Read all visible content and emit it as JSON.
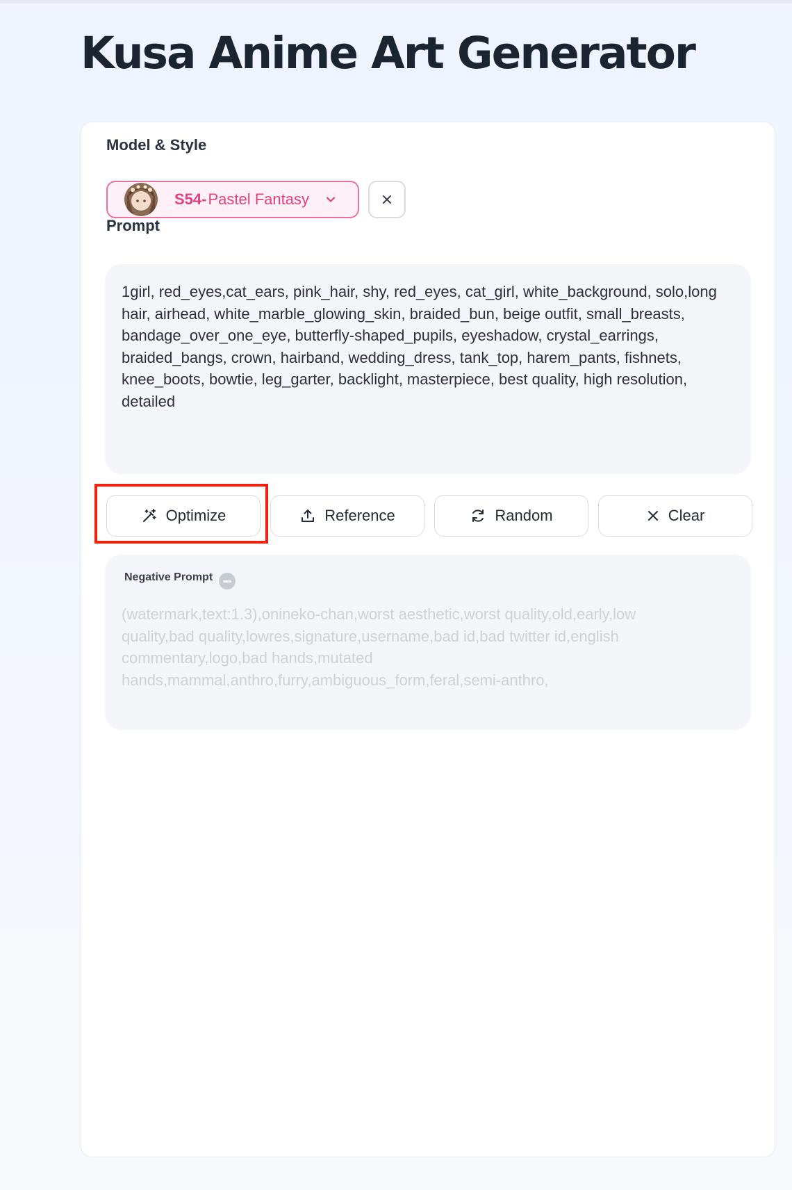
{
  "page": {
    "title": "Kusa Anime Art Generator"
  },
  "model_section": {
    "label": "Model & Style",
    "selected_code": "S54-",
    "selected_name": "Pastel Fantasy",
    "accent_color": "#e2407f",
    "clear_icon": "close-icon",
    "dropdown_icon": "chevron-down-icon"
  },
  "prompt_section": {
    "label": "Prompt",
    "value": "1girl, red_eyes,cat_ears, pink_hair, shy, red_eyes, cat_girl, white_background, solo,long hair, airhead, white_marble_glowing_skin, braided_bun, beige outfit, small_breasts, bandage_over_one_eye, butterfly-shaped_pupils, eyeshadow, crystal_earrings, braided_bangs, crown, hairband, wedding_dress, tank_top, harem_pants, fishnets, knee_boots, bowtie, leg_garter, backlight, masterpiece, best quality, high resolution, detailed"
  },
  "actions": [
    {
      "label": "Optimize",
      "icon": "magic-wand-icon"
    },
    {
      "label": "Reference",
      "icon": "upload-icon"
    },
    {
      "label": "Random",
      "icon": "refresh-icon"
    },
    {
      "label": "Clear",
      "icon": "close-icon"
    }
  ],
  "negative_prompt": {
    "label": "Negative Prompt",
    "toggle_icon": "minus-circle-icon",
    "value": "(watermark,text:1.3),onineko-chan,worst aesthetic,worst quality,old,early,low quality,bad quality,lowres,signature,username,bad id,bad twitter id,english commentary,logo,bad hands,mutated hands,mammal,anthro,furry,ambiguous_form,feral,semi-anthro,"
  },
  "highlight_color": "#f0210f"
}
